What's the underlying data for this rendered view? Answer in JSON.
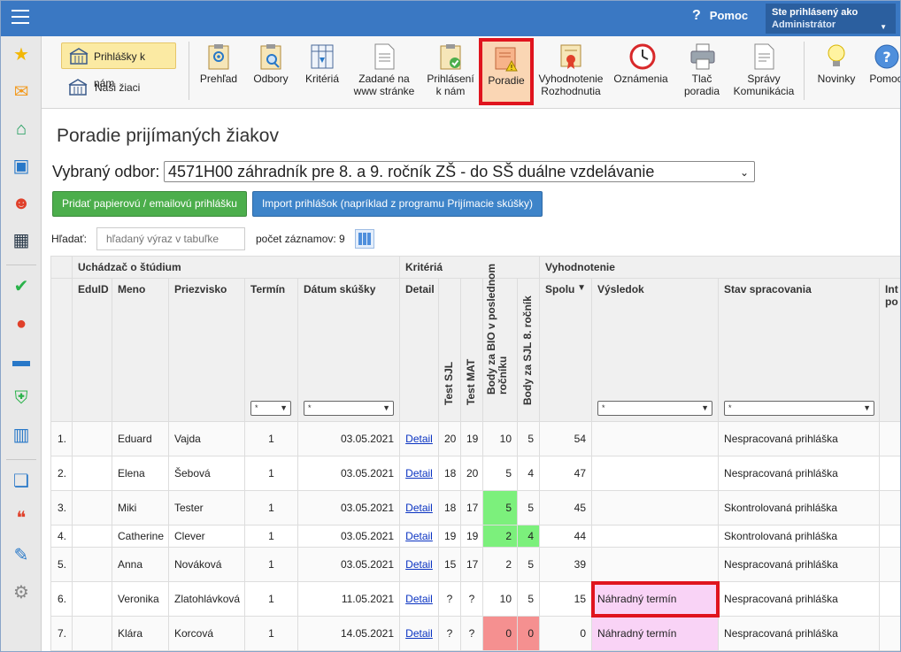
{
  "topbar": {
    "help_label": "Pomoc",
    "user_label": "Ste prihlásený ako",
    "user_role": "Administrátor"
  },
  "ribbon": {
    "tabs": [
      {
        "label": "Prihlášky k nám"
      },
      {
        "label": "Naši žiaci"
      }
    ],
    "buttons": [
      {
        "label": "Prehľad",
        "icon": "clipboard-eye-icon"
      },
      {
        "label": "Odbory",
        "icon": "clipboard-search-icon"
      },
      {
        "label": "Kritériá",
        "icon": "table-filter-icon"
      },
      {
        "label": "Zadané na www stránke",
        "icon": "web-form-icon"
      },
      {
        "label": "Prihlásení k nám",
        "icon": "clipboard-check-icon"
      },
      {
        "label": "Poradie",
        "icon": "ranking-warning-icon"
      },
      {
        "label": "Vyhodnotenie Rozhodnutia",
        "icon": "certificate-icon"
      },
      {
        "label": "Oznámenia",
        "icon": "clock-icon"
      },
      {
        "label": "Tlač poradia",
        "icon": "printer-icon"
      },
      {
        "label": "Správy Komunikácia",
        "icon": "document-icon"
      },
      {
        "label": "Novinky",
        "icon": "lightbulb-icon"
      },
      {
        "label": "Pomoc",
        "icon": "help-icon"
      }
    ]
  },
  "sidebar": {
    "icons": [
      "star-icon",
      "envelope-icon",
      "home-icon",
      "book-icon",
      "user-icon",
      "calendar-icon",
      "check-circle-icon",
      "grade-icon",
      "briefcase-icon",
      "shield-icon",
      "chart-icon",
      "open-book-icon",
      "chat-icon",
      "pen-icon",
      "gear-icon"
    ]
  },
  "page": {
    "title": "Poradie prijímaných žiakov",
    "odbor_label": "Vybraný odbor:",
    "odbor_value": "4571H00 záhradník pre 8. a 9. ročník ZŠ - do SŠ duálne vzdelávanie",
    "add_button": "Pridať papierovú / emailovú prihlášku",
    "import_button": "Import prihlášok (napríklad z programu Prijímacie skúšky)",
    "search_label": "Hľadať:",
    "search_placeholder": "hľadaný výraz v tabuľke",
    "count_label": "počet záznamov: 9"
  },
  "table": {
    "groups": [
      "Uchádzač o štúdium",
      "Kritériá",
      "Vyhodnotenie"
    ],
    "columns": [
      "EduID",
      "Meno",
      "Priezvisko",
      "Termín",
      "Dátum skúšky",
      "Detail",
      "Test SJL",
      "Test MAT",
      "Body za BIO v poslednom ročníku",
      "Body za SJL 8. ročník",
      "Spolu",
      "Výsledok",
      "Stav spracovania",
      "Int po"
    ],
    "filter_value": "*",
    "sort_indicator": "▼",
    "rows": [
      {
        "n": "1.",
        "eduid": "",
        "meno": "Eduard",
        "priezvisko": "Vajda",
        "termin": "1",
        "datum": "03.05.2021",
        "detail": "Detail",
        "sjl": "20",
        "mat": "19",
        "bio": "10",
        "sjl8": "5",
        "spolu": "54",
        "vysledok": "",
        "stav": "Nespracovaná prihláška"
      },
      {
        "n": "2.",
        "eduid": "",
        "meno": "Elena",
        "priezvisko": "Šebová",
        "termin": "1",
        "datum": "03.05.2021",
        "detail": "Detail",
        "sjl": "18",
        "mat": "20",
        "bio": "5",
        "sjl8": "4",
        "spolu": "47",
        "vysledok": "",
        "stav": "Nespracovaná prihláška"
      },
      {
        "n": "3.",
        "eduid": "",
        "meno": "Miki",
        "priezvisko": "Tester",
        "termin": "1",
        "datum": "03.05.2021",
        "detail": "Detail",
        "sjl": "18",
        "mat": "17",
        "bio": "5",
        "sjl8": "5",
        "spolu": "45",
        "vysledok": "",
        "stav": "Skontrolovaná prihláška"
      },
      {
        "n": "4.",
        "eduid": "",
        "meno": "Catherine",
        "priezvisko": "Clever",
        "termin": "1",
        "datum": "03.05.2021",
        "detail": "Detail",
        "sjl": "19",
        "mat": "19",
        "bio": "2",
        "sjl8": "4",
        "spolu": "44",
        "vysledok": "",
        "stav": "Skontrolovaná prihláška"
      },
      {
        "n": "5.",
        "eduid": "",
        "meno": "Anna",
        "priezvisko": "Nováková",
        "termin": "1",
        "datum": "03.05.2021",
        "detail": "Detail",
        "sjl": "15",
        "mat": "17",
        "bio": "2",
        "sjl8": "5",
        "spolu": "39",
        "vysledok": "",
        "stav": "Nespracovaná prihláška"
      },
      {
        "n": "6.",
        "eduid": "",
        "meno": "Veronika",
        "priezvisko": "Zlatohlávková",
        "termin": "1",
        "datum": "11.05.2021",
        "detail": "Detail",
        "sjl": "?",
        "mat": "?",
        "bio": "10",
        "sjl8": "5",
        "spolu": "15",
        "vysledok": "Náhradný termín",
        "stav": "Nespracovaná prihláška"
      },
      {
        "n": "7.",
        "eduid": "",
        "meno": "Klára",
        "priezvisko": "Korcová",
        "termin": "1",
        "datum": "14.05.2021",
        "detail": "Detail",
        "sjl": "?",
        "mat": "?",
        "bio": "0",
        "sjl8": "0",
        "spolu": "0",
        "vysledok": "Náhradný termín",
        "stav": "Nespracovaná prihláška"
      }
    ]
  },
  "colors": {
    "topbar": "#3a78c3",
    "highlight_red": "#e0141e",
    "green_cell": "#7cf07c",
    "red_cell": "#f59090",
    "pink_cell": "#f9d3f6"
  }
}
